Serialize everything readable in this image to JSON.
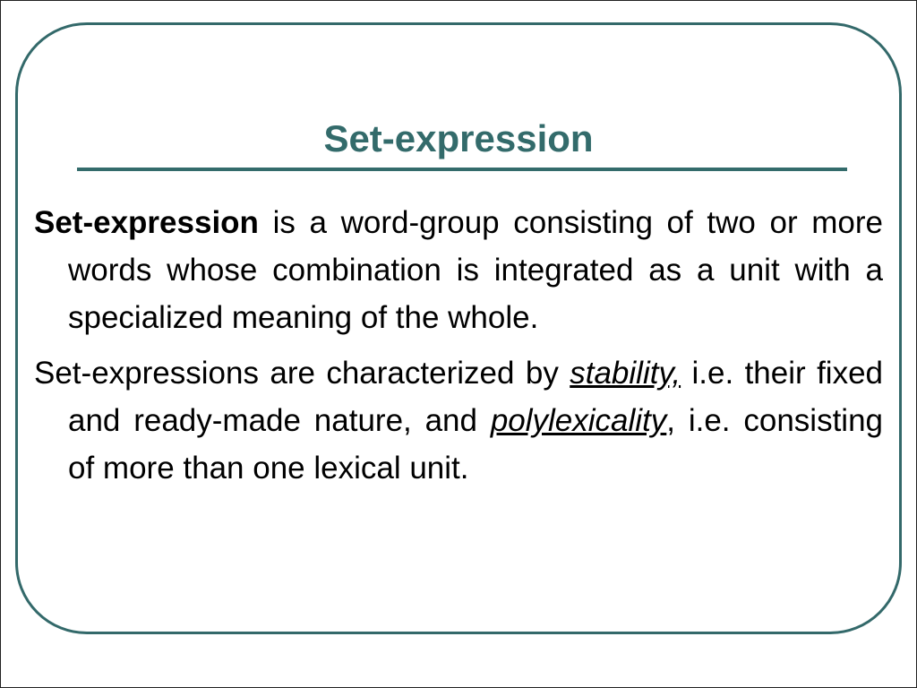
{
  "slide": {
    "title": "Set-expression",
    "paragraphs": [
      {
        "term": "Set-expression",
        "text": " is a word-group consisting of two or more words whose combination is integrated as a unit with a specialized meaning of the whole."
      },
      {
        "part1": "Set-expressions are characterized by ",
        "emph1": "stability,",
        "part2": " i.e. their fixed and ready-made nature, and ",
        "emph2": "polylexicality",
        "part3": ", i.e. consisting of more than one lexical unit."
      }
    ]
  },
  "colors": {
    "accent": "#336b6b",
    "text": "#000000",
    "background": "#ffffff"
  }
}
